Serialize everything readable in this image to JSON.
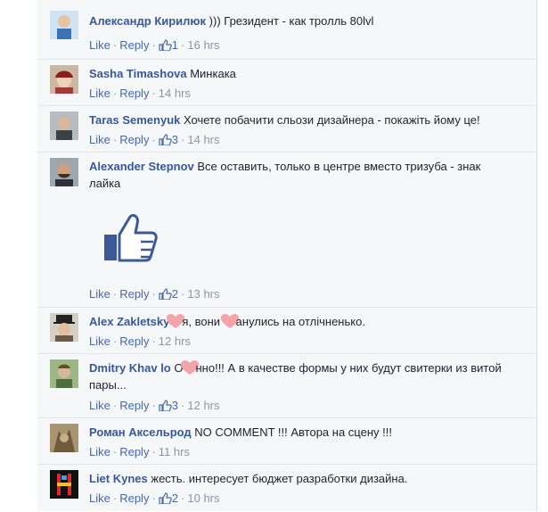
{
  "colors": {
    "link": "#4267b2",
    "author": "#365899",
    "meta": "#90949c",
    "background": "#f6f7f9"
  },
  "labels": {
    "like": "Like",
    "reply": "Reply"
  },
  "comments": [
    {
      "author": "Александр Кирилюк",
      "text": ")))  Грезидент - как тролль 80lvl",
      "likes": "1",
      "time": "16 hrs"
    },
    {
      "author": "Sasha Timashova",
      "text": "Минкака",
      "likes": "",
      "time": "14 hrs"
    },
    {
      "author": "Taras Semenyuk",
      "text": "Хочете побачити сльози дизайнера - покажіть йому це!",
      "likes": "3",
      "time": "14 hrs"
    },
    {
      "author": "Alexander Stepnov",
      "text": "Все оставить, только в центре вместо тризуба - знак лайка",
      "likes": "2",
      "time": "13 hrs"
    },
    {
      "author": "Alex Zakletsky",
      "text_a": "я, вони ",
      "text_b": "анулись на отлічненько.",
      "likes": "",
      "time": "12 hrs"
    },
    {
      "author": "Dmitry Khav lo",
      "text_a": "О",
      "text_b": "нно!!! А в качестве формы у них будут свитерки из витой пары...",
      "likes": "3",
      "time": "12 hrs"
    },
    {
      "author": "Роман Аксельрод",
      "text": "NO COMMENT !!! Автора на сцену !!!",
      "likes": "",
      "time": "11 hrs"
    },
    {
      "author": "Liet Kynes",
      "text": "жесть. интересует бюджет разработки дизайна.",
      "likes": "2",
      "time": "10 hrs"
    }
  ]
}
